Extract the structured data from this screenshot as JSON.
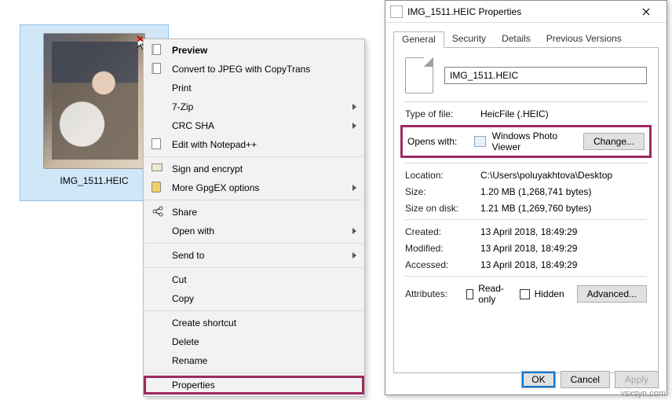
{
  "file": {
    "name": "IMG_1511.HEIC"
  },
  "context_menu": {
    "preview": "Preview",
    "convert": "Convert to JPEG with CopyTrans",
    "print": "Print",
    "seven_zip": "7-Zip",
    "crc_sha": "CRC SHA",
    "edit_npp": "Edit with Notepad++",
    "sign_encrypt": "Sign and encrypt",
    "more_gpg": "More GpgEX options",
    "share": "Share",
    "open_with": "Open with",
    "send_to": "Send to",
    "cut": "Cut",
    "copy": "Copy",
    "create_shortcut": "Create shortcut",
    "delete": "Delete",
    "rename": "Rename",
    "properties": "Properties"
  },
  "dialog": {
    "title": "IMG_1511.HEIC Properties",
    "tabs": {
      "general": "General",
      "security": "Security",
      "details": "Details",
      "previous": "Previous Versions"
    },
    "filename": "IMG_1511.HEIC",
    "labels": {
      "type_of_file": "Type of file:",
      "opens_with": "Opens with:",
      "location": "Location:",
      "size": "Size:",
      "size_on_disk": "Size on disk:",
      "created": "Created:",
      "modified": "Modified:",
      "accessed": "Accessed:",
      "attributes": "Attributes:",
      "read_only": "Read-only",
      "hidden": "Hidden"
    },
    "values": {
      "type": "HeicFile (.HEIC)",
      "opens_with_app": "Windows Photo Viewer",
      "location": "C:\\Users\\poluyakhtova\\Desktop",
      "size": "1.20 MB (1,268,741 bytes)",
      "size_on_disk": "1.21 MB (1,269,760 bytes)",
      "created": "13 April 2018, 18:49:29",
      "modified": "13 April 2018, 18:49:29",
      "accessed": "13 April 2018, 18:49:29"
    },
    "buttons": {
      "change": "Change...",
      "advanced": "Advanced...",
      "ok": "OK",
      "cancel": "Cancel",
      "apply": "Apply"
    }
  },
  "watermark": "vsxsyn.com"
}
